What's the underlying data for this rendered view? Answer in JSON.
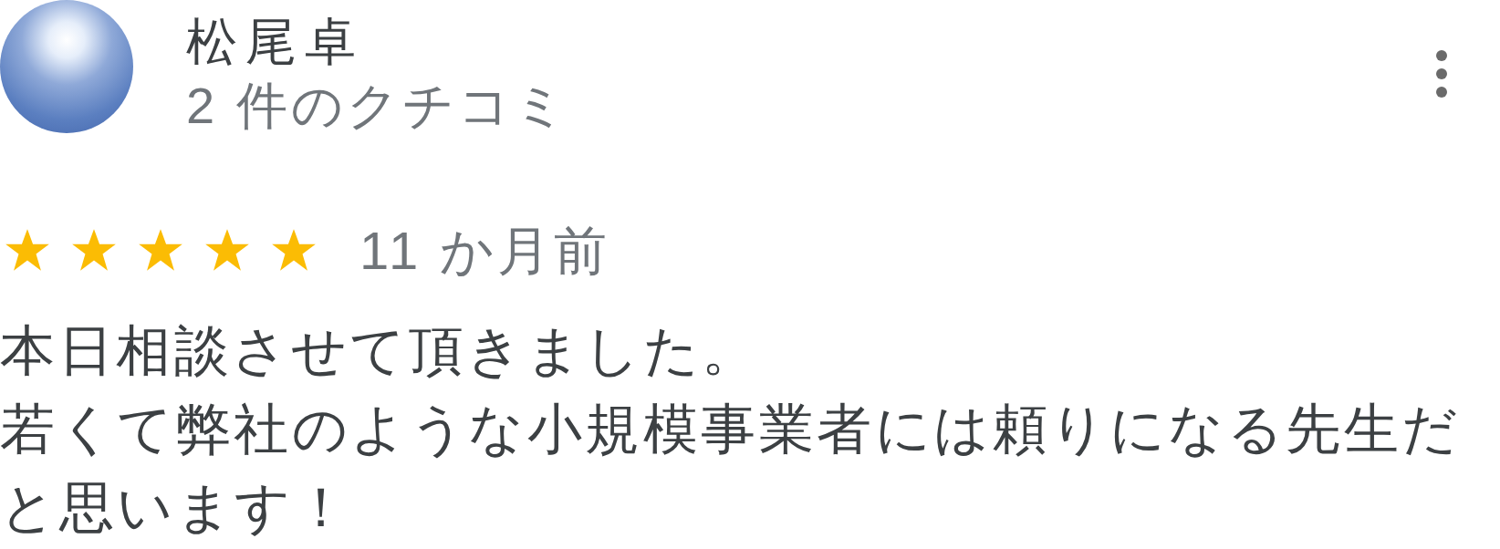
{
  "reviewer": {
    "name": "松尾卓",
    "review_count": "2 件のクチコミ"
  },
  "review": {
    "stars": 5,
    "time": "11 か月前",
    "paragraphs": [
      "本日相談させて頂きました。",
      "若くて弊社のような小規模事業者には頼りになる先生だと思います！"
    ]
  }
}
